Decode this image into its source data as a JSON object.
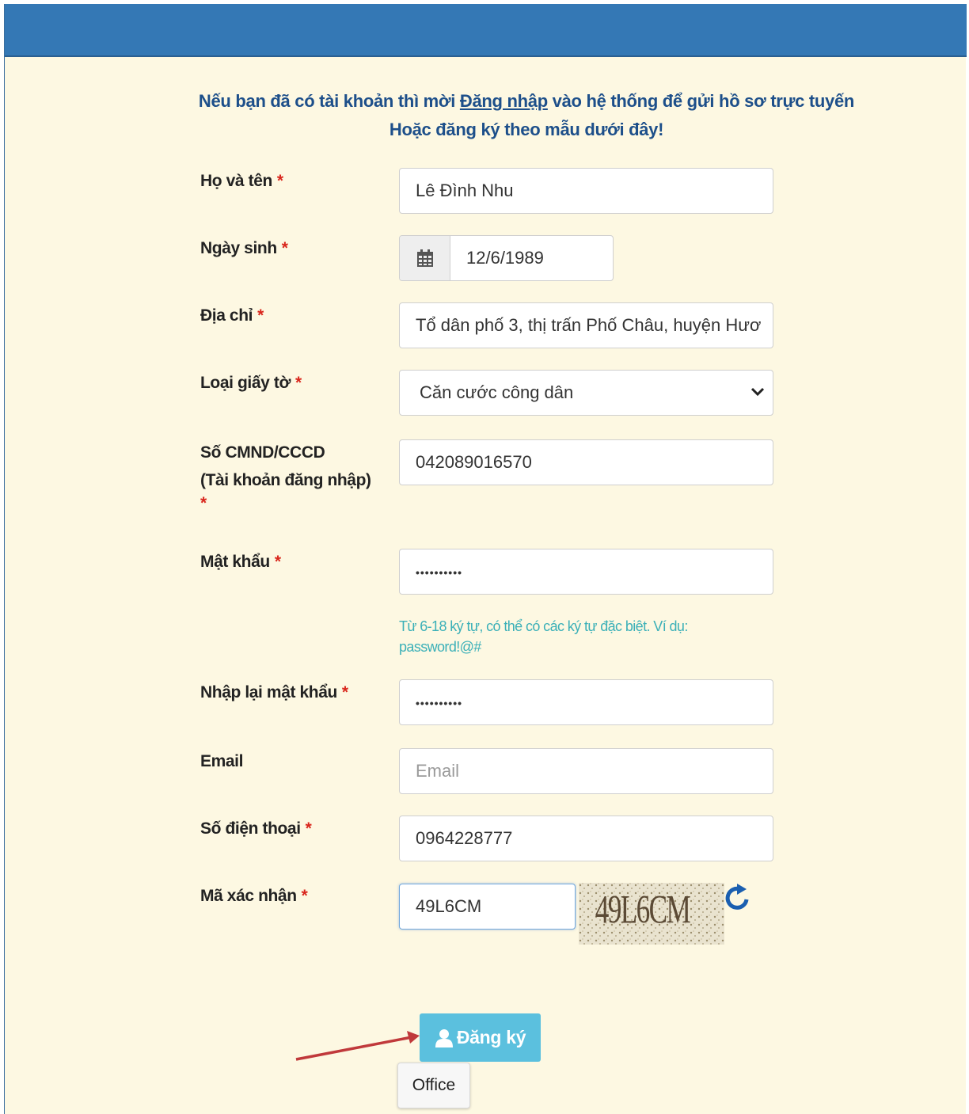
{
  "intro": {
    "line1_before": "Nếu bạn đã có tài khoản thì mời ",
    "login_link": "Đăng nhập",
    "line1_after": " vào hệ thống để gửi hồ sơ trực tuyến",
    "line2": "Hoặc đăng ký theo mẫu dưới đây!"
  },
  "required_mark": "*",
  "form": {
    "fullname": {
      "label": "Họ và tên",
      "value": "Lê Đình Nhu"
    },
    "dob": {
      "label": "Ngày sinh",
      "value": "12/6/1989",
      "icon": "calendar-icon"
    },
    "address": {
      "label": "Địa chỉ",
      "value": "Tổ dân phố 3, thị trấn Phố Châu, huyện Hươ"
    },
    "doc_type": {
      "label": "Loại giấy tờ",
      "value": "Căn cước công dân"
    },
    "id_number": {
      "label_line1": "Số CMND/CCCD",
      "label_line2": "(Tài khoản đăng nhập)",
      "value": "042089016570"
    },
    "password": {
      "label": "Mật khẩu",
      "value": "••••••••••",
      "hint": "Từ 6-18 ký tự, có thể có các ký tự đặc biệt. Ví dụ: password!@#"
    },
    "password_confirm": {
      "label": "Nhập lại mật khẩu",
      "value": "••••••••••"
    },
    "email": {
      "label": "Email",
      "placeholder": "Email"
    },
    "phone": {
      "label": "Số điện thoại",
      "value": "0964228777"
    },
    "captcha": {
      "label": "Mã xác nhận",
      "value": "49L6CM",
      "image_text": "49L6CM"
    }
  },
  "submit": {
    "label": "Đăng ký",
    "icon": "user-icon"
  },
  "tooltip": {
    "text": "Office"
  },
  "colors": {
    "header": "#3478b5",
    "background": "#fdf8e2",
    "button": "#5bc0de",
    "required": "#d9261c",
    "arrow": "#c0393b"
  }
}
